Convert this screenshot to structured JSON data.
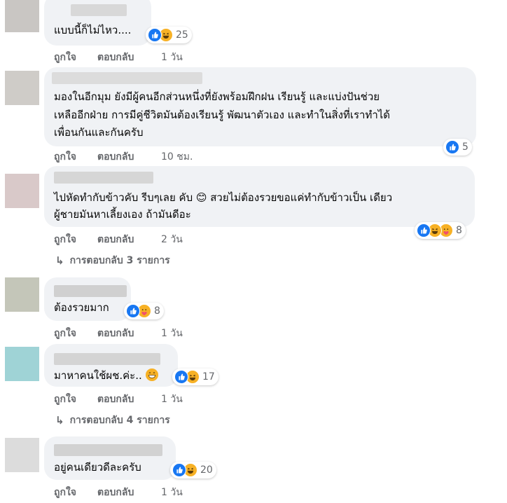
{
  "colors": {
    "bubble": "#f0f2f5",
    "meta_text": "#65676b",
    "like_blue": "#1877f2",
    "emoji_yellow": "#f7b125"
  },
  "comments": [
    {
      "avatar_color": "#c9c6c3",
      "name_blur_color": "#d8d8d8",
      "text_lines": [
        "แบบนี้ก็ไม่ไหว...."
      ],
      "reactions": [
        "like-icon",
        "haha-icon"
      ],
      "reaction_count": "25",
      "like_label": "ถูกใจ",
      "reply_label": "ตอบกลับ",
      "time": "1 วัน"
    },
    {
      "avatar_color": "#cfccc8",
      "name_blur_color": "#dcdcdc",
      "text_lines": [
        "มองในอีกมุม ยังมีผู้คนอีกส่วนหนึ่งที่ยังพร้อมฝึกฝน เรียนรู้ และแบ่งปันช่วย",
        "เหลืออีกฝ่าย การมีคู่ชีวิตมันต้องเรียนรู้ พัฒนาตัวเอง และทำในสิ่งที่เราทำได้",
        "เพื่อนกันและกันครับ"
      ],
      "reactions": [
        "like-icon"
      ],
      "reaction_count": "5",
      "like_label": "ถูกใจ",
      "reply_label": "ตอบกลับ",
      "time": "10 ชม."
    },
    {
      "avatar_color": "#d9c9c9",
      "name_blur_color": "#d6d6d6",
      "text_lines": [
        "ไปหัดทำกับข้าวคับ รีบๆเลย คับ 😊 สวยไม่ต้องรวยขอแค่ทำกับข้าวเป็น เดียว",
        "ผู้ชายมันหาเลี้ยงเอง ถ้ามันดีอะ"
      ],
      "reactions": [
        "like-icon",
        "haha-icon",
        "care-icon"
      ],
      "reaction_count": "8",
      "like_label": "ถูกใจ",
      "reply_label": "ตอบกลับ",
      "time": "2 วัน",
      "replies_label": "การตอบกลับ 3 รายการ"
    },
    {
      "avatar_color": "#c4c6b9",
      "name_blur_color": "#d0d0d0",
      "text_lines": [
        "ต้องรวยมาก"
      ],
      "reactions": [
        "like-icon",
        "care-icon"
      ],
      "reaction_count": "8",
      "like_label": "ถูกใจ",
      "reply_label": "ตอบกลับ",
      "time": "1 วัน"
    },
    {
      "avatar_color": "#9fd3d6",
      "name_blur_color": "#d4d4d4",
      "text_lines": [
        "มาหาคนใช้ผช.ค่ะ.."
      ],
      "reactions": [
        "like-icon",
        "haha-icon"
      ],
      "reaction_count": "17",
      "like_label": "ถูกใจ",
      "reply_label": "ตอบกลับ",
      "time": "1 วัน",
      "replies_label": "การตอบกลับ 4 รายการ"
    },
    {
      "avatar_color": "#dcdcdc",
      "name_blur_color": "#d2d2d2",
      "text_lines": [
        "อยู่คนเดียวดีละครับ"
      ],
      "reactions": [
        "like-icon",
        "haha-icon"
      ],
      "reaction_count": "20",
      "like_label": "ถูกใจ",
      "reply_label": "ตอบกลับ",
      "time": "1 วัน"
    }
  ]
}
